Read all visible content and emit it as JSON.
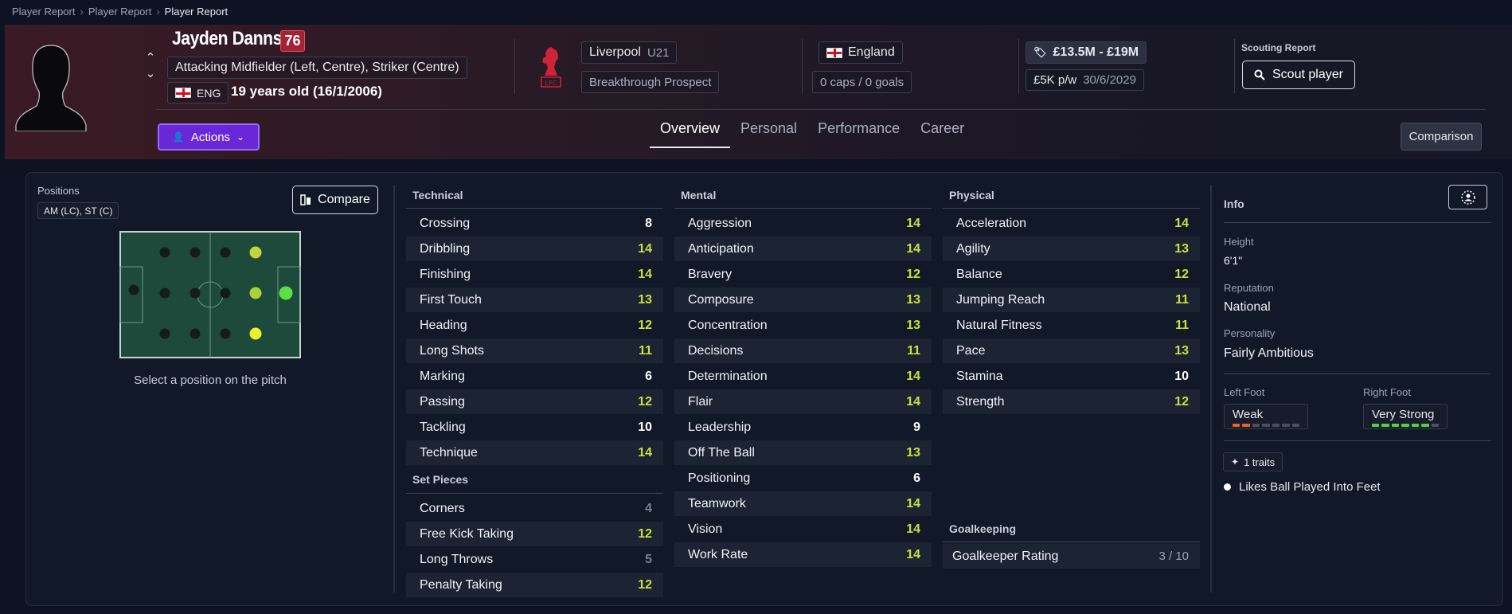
{
  "breadcrumb": [
    "Player Report",
    "Player Report",
    "Player Report"
  ],
  "player": {
    "name": "Jayden Danns",
    "ability_badge": "76",
    "positions": "Attacking Midfielder (Left, Centre), Striker (Centre)",
    "nationality_code": "ENG",
    "age": "19 years old (16/1/2006)"
  },
  "club": {
    "name": "Liverpool",
    "team": "U21",
    "status": "Breakthrough Prospect"
  },
  "nation": {
    "name": "England",
    "caps": "0 caps / 0 goals"
  },
  "value": {
    "range": "£13.5M - £19M",
    "wage": "£5K p/w",
    "contract": "30/6/2029"
  },
  "scouting": {
    "label": "Scouting Report",
    "button": "Scout player"
  },
  "actions_label": "Actions",
  "tabs": [
    {
      "label": "Overview",
      "active": true
    },
    {
      "label": "Personal",
      "active": false
    },
    {
      "label": "Performance",
      "active": false
    },
    {
      "label": "Career",
      "active": false
    }
  ],
  "comparison_label": "Comparison",
  "positions_panel": {
    "title": "Positions",
    "chip": "AM (LC), ST (C)",
    "compare_label": "Compare",
    "caption": "Select a position on the pitch"
  },
  "technical": {
    "title": "Technical",
    "attrs": [
      {
        "name": "Crossing",
        "value": "8"
      },
      {
        "name": "Dribbling",
        "value": "14"
      },
      {
        "name": "Finishing",
        "value": "14"
      },
      {
        "name": "First Touch",
        "value": "13"
      },
      {
        "name": "Heading",
        "value": "12"
      },
      {
        "name": "Long Shots",
        "value": "11"
      },
      {
        "name": "Marking",
        "value": "6"
      },
      {
        "name": "Passing",
        "value": "12"
      },
      {
        "name": "Tackling",
        "value": "10"
      },
      {
        "name": "Technique",
        "value": "14"
      }
    ]
  },
  "set_pieces": {
    "title": "Set Pieces",
    "attrs": [
      {
        "name": "Corners",
        "value": "4"
      },
      {
        "name": "Free Kick Taking",
        "value": "12"
      },
      {
        "name": "Long Throws",
        "value": "5"
      },
      {
        "name": "Penalty Taking",
        "value": "12"
      }
    ]
  },
  "mental": {
    "title": "Mental",
    "attrs": [
      {
        "name": "Aggression",
        "value": "14"
      },
      {
        "name": "Anticipation",
        "value": "14"
      },
      {
        "name": "Bravery",
        "value": "12"
      },
      {
        "name": "Composure",
        "value": "13"
      },
      {
        "name": "Concentration",
        "value": "13"
      },
      {
        "name": "Decisions",
        "value": "11"
      },
      {
        "name": "Determination",
        "value": "14"
      },
      {
        "name": "Flair",
        "value": "14"
      },
      {
        "name": "Leadership",
        "value": "9"
      },
      {
        "name": "Off The Ball",
        "value": "13"
      },
      {
        "name": "Positioning",
        "value": "6"
      },
      {
        "name": "Teamwork",
        "value": "14"
      },
      {
        "name": "Vision",
        "value": "14"
      },
      {
        "name": "Work Rate",
        "value": "14"
      }
    ]
  },
  "physical": {
    "title": "Physical",
    "attrs": [
      {
        "name": "Acceleration",
        "value": "14"
      },
      {
        "name": "Agility",
        "value": "13"
      },
      {
        "name": "Balance",
        "value": "12"
      },
      {
        "name": "Jumping Reach",
        "value": "11"
      },
      {
        "name": "Natural Fitness",
        "value": "11"
      },
      {
        "name": "Pace",
        "value": "13"
      },
      {
        "name": "Stamina",
        "value": "10"
      },
      {
        "name": "Strength",
        "value": "12"
      }
    ]
  },
  "goalkeeping": {
    "title": "Goalkeeping",
    "label": "Goalkeeper Rating",
    "value": "3 / 10"
  },
  "info": {
    "title": "Info",
    "height_label": "Height",
    "height": "6'1\"",
    "reputation_label": "Reputation",
    "reputation": "National",
    "personality_label": "Personality",
    "personality": "Fairly Ambitious",
    "left_foot_label": "Left Foot",
    "left_foot": "Weak",
    "left_foot_level": 2,
    "right_foot_label": "Right Foot",
    "right_foot": "Very Strong",
    "right_foot_level": 6,
    "traits_label": "1 traits",
    "trait": "Likes Ball Played Into Feet"
  },
  "colors": {
    "accent_purple": "#6a27d8",
    "attr_high": "#c8e23a",
    "badge_red": "#a32233"
  }
}
